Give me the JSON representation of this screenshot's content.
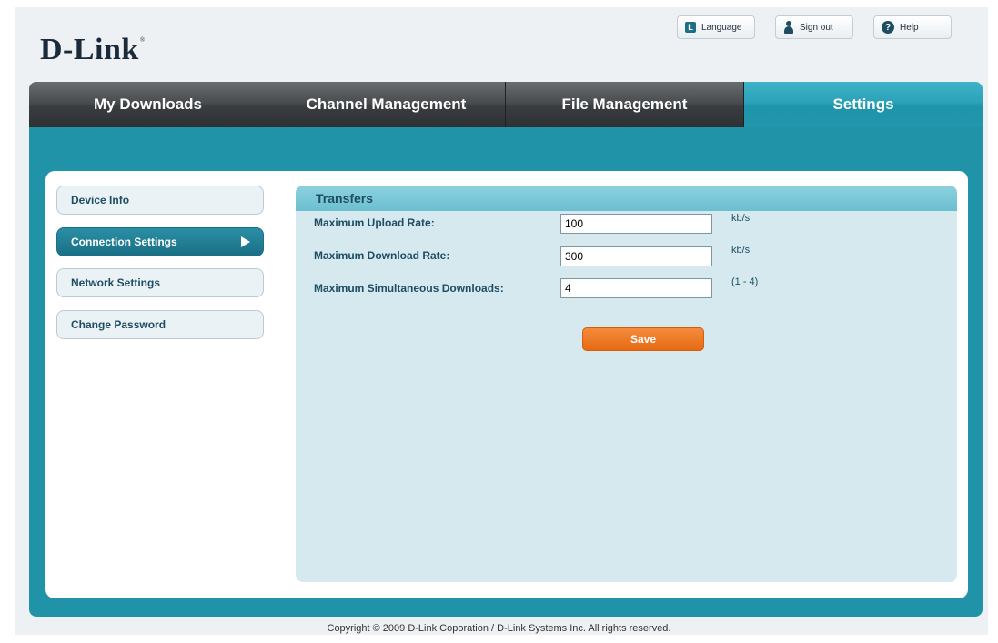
{
  "header": {
    "logo": "D-Link",
    "logo_mark": "®",
    "language_label": "Language",
    "signout_label": "Sign out",
    "help_label": "Help"
  },
  "tabs": [
    {
      "label": "My Downloads",
      "active": false
    },
    {
      "label": "Channel Management",
      "active": false
    },
    {
      "label": "File Management",
      "active": false
    },
    {
      "label": "Settings",
      "active": true
    }
  ],
  "sidebar": {
    "items": [
      {
        "label": "Device Info",
        "active": false
      },
      {
        "label": "Connection Settings",
        "active": true
      },
      {
        "label": "Network Settings",
        "active": false
      },
      {
        "label": "Change Password",
        "active": false
      }
    ]
  },
  "transfers": {
    "title": "Transfers",
    "rows": [
      {
        "label": "Maximum Upload Rate:",
        "value": "100",
        "unit": "kb/s"
      },
      {
        "label": "Maximum Download Rate:",
        "value": "300",
        "unit": "kb/s"
      },
      {
        "label": "Maximum Simultaneous Downloads:",
        "value": "4",
        "unit": "(1 - 4)"
      }
    ],
    "save_label": "Save"
  },
  "footer": {
    "copyright": "Copyright © 2009 D-Link Coporation / D-Link Systems Inc. All rights reserved."
  },
  "colors": {
    "accent": "#2093a8",
    "save": "#ee7a22",
    "text": "#1e4d63"
  }
}
